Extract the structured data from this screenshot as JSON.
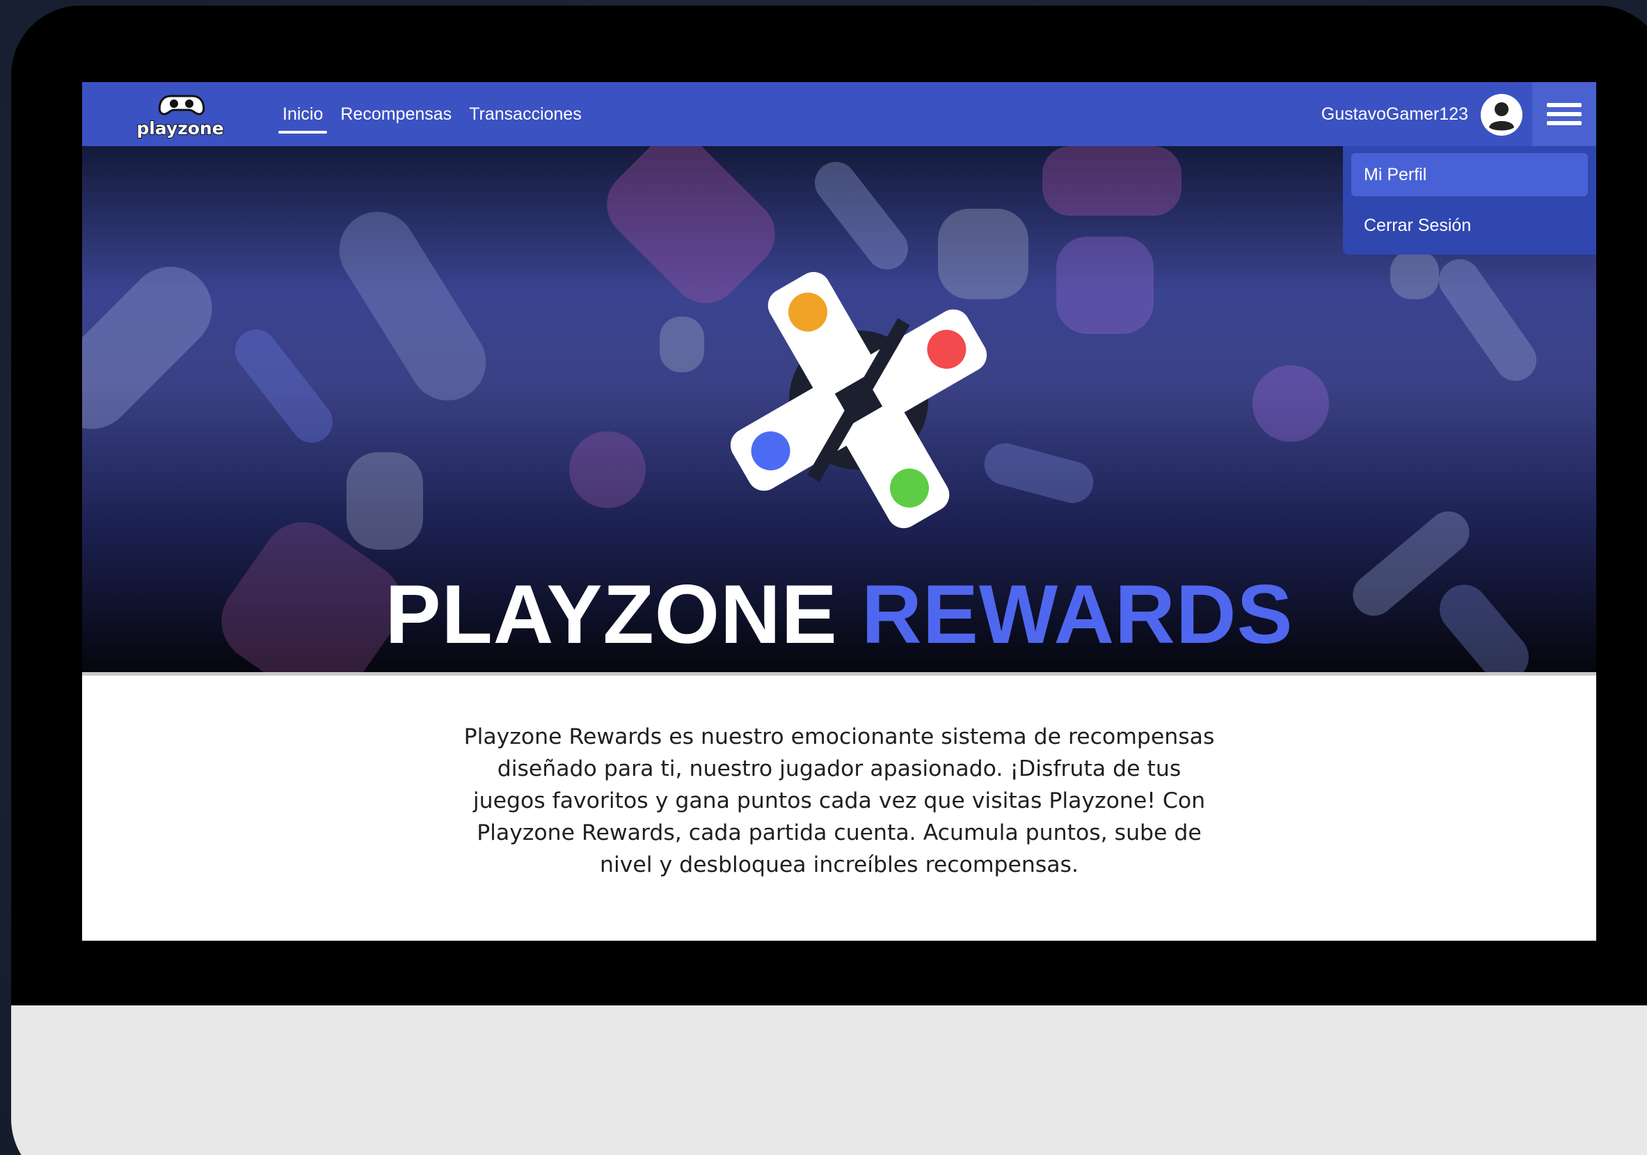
{
  "app": {
    "logo_text": "playzone"
  },
  "navbar": {
    "links": [
      {
        "label": "Inicio",
        "active": true
      },
      {
        "label": "Recompensas",
        "active": false
      },
      {
        "label": "Transacciones",
        "active": false
      }
    ],
    "username": "GustavoGamer123",
    "avatar_icon": "user-avatar-icon",
    "menu_icon": "hamburger-menu-icon"
  },
  "dropdown": {
    "items": [
      {
        "label": "Mi Perfil",
        "selected": true
      },
      {
        "label": "Cerrar Sesión",
        "selected": false
      }
    ]
  },
  "hero": {
    "title_part1": "PLAYZONE",
    "title_part2": "REWARDS"
  },
  "description": {
    "text": "Playzone Rewards es nuestro emocionante sistema de recompensas\ndiseñado para ti, nuestro jugador apasionado. ¡Disfruta de tus\njuegos favoritos y gana puntos cada vez que visitas Playzone! Con\nPlayzone Rewards, cada partida cuenta. Acumula puntos, sube de\nnivel y desbloquea increíbles recompensas."
  },
  "colors": {
    "navbar": "#3b52c2",
    "accent_blue": "#4f67ee",
    "button_orange": "#f0a326",
    "button_red": "#f24a4d",
    "button_blue": "#4b6bf2",
    "button_green": "#5ccd45"
  }
}
